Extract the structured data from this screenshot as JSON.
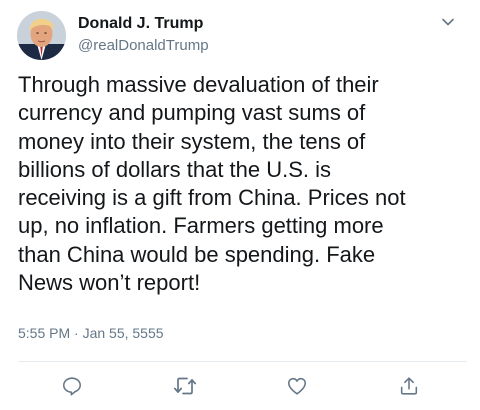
{
  "author": {
    "display_name": "Donald J. Trump",
    "handle": "@realDonaldTrump"
  },
  "tweet": {
    "text": "Through massive devaluation of their\ncurrency and pumping vast sums of\nmoney into their system, the tens of\nbillions of dollars that the U.S. is\nreceiving is a gift from China. Prices not\nup, no inflation. Farmers getting more\nthan China would be spending. Fake\nNews won’t report!",
    "timestamp": "5:55 PM · Jan 55, 5555"
  },
  "icons": {
    "menu": "chevron-down-icon",
    "reply": "reply-icon",
    "retweet": "retweet-icon",
    "like": "heart-icon",
    "share": "share-icon"
  },
  "colors": {
    "primary_text": "#14171a",
    "secondary_text": "#657786",
    "icon": "#657786",
    "divider": "#e6ecf0"
  }
}
